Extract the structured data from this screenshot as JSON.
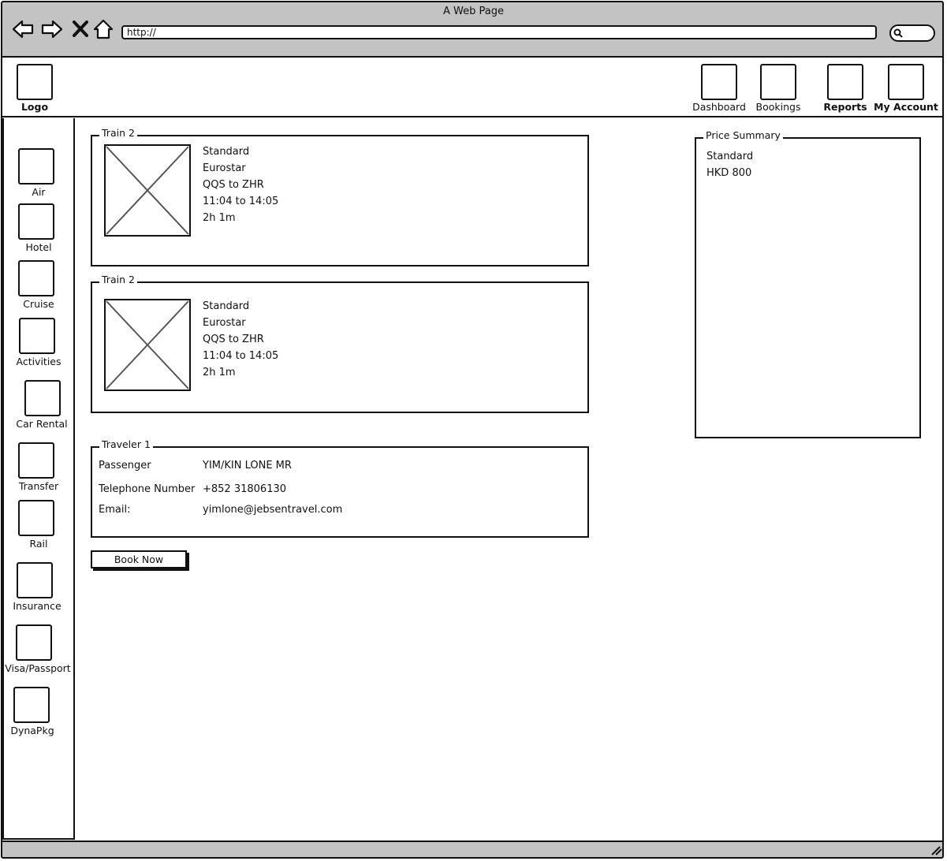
{
  "browser": {
    "title": "A Web Page",
    "url": "http://"
  },
  "header": {
    "logo_label": "Logo",
    "nav": [
      {
        "label": "Dashboard"
      },
      {
        "label": "Bookings"
      },
      {
        "label": "Reports"
      },
      {
        "label": "My Account"
      }
    ]
  },
  "sidebar": {
    "items": [
      {
        "label": "Air"
      },
      {
        "label": "Hotel"
      },
      {
        "label": "Cruise"
      },
      {
        "label": "Activities"
      },
      {
        "label": "Car Rental"
      },
      {
        "label": "Transfer"
      },
      {
        "label": "Rail"
      },
      {
        "label": "Insurance"
      },
      {
        "label": "Visa/Passport"
      },
      {
        "label": "DynaPkg"
      }
    ]
  },
  "trains": [
    {
      "title": "Train 2",
      "class": "Standard",
      "operator": "Eurostar",
      "route": "QQS to ZHR",
      "time": "11:04 to 14:05",
      "duration": "2h 1m"
    },
    {
      "title": "Train 2",
      "class": "Standard",
      "operator": "Eurostar",
      "route": "QQS to ZHR",
      "time": "11:04 to 14:05",
      "duration": "2h 1m"
    }
  ],
  "traveler": {
    "title": "Traveler 1",
    "passenger_label": "Passenger",
    "passenger_value": "YIM/KIN LONE MR",
    "phone_label": "Telephone Number",
    "phone_value": "+852 31806130",
    "email_label": "Email:",
    "email_value": "yimlone@jebsentravel.com"
  },
  "book_button": "Book Now",
  "price_summary": {
    "title": "Price Summary",
    "class": "Standard",
    "amount": "HKD 800"
  }
}
